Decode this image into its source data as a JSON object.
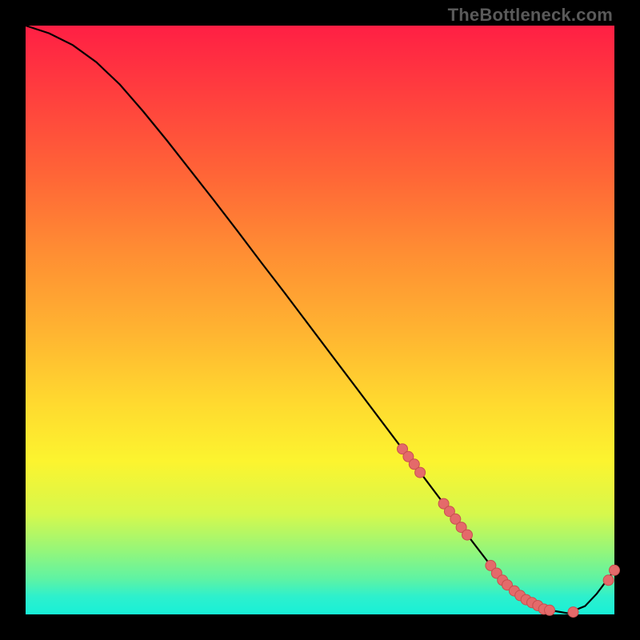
{
  "watermark": "TheBottleneck.com",
  "colors": {
    "curve": "#000000",
    "marker_fill": "#e46a6a",
    "marker_stroke": "#c84f4f"
  },
  "chart_data": {
    "type": "line",
    "title": "",
    "xlabel": "",
    "ylabel": "",
    "xlim": [
      0,
      100
    ],
    "ylim": [
      0,
      100
    ],
    "grid": false,
    "legend": false,
    "series": [
      {
        "name": "curve",
        "x": [
          0,
          4,
          8,
          12,
          16,
          20,
          24,
          28,
          32,
          36,
          40,
          44,
          48,
          52,
          56,
          60,
          64,
          68,
          72,
          76,
          80,
          84,
          88,
          92,
          95,
          97,
          100
        ],
        "y": [
          100.0,
          98.7,
          96.7,
          93.8,
          90.0,
          85.4,
          80.5,
          75.4,
          70.3,
          65.1,
          59.8,
          54.6,
          49.3,
          44.0,
          38.7,
          33.4,
          28.1,
          22.8,
          17.5,
          12.2,
          7.0,
          3.2,
          0.9,
          0.2,
          1.4,
          3.5,
          7.5
        ]
      }
    ],
    "markers": [
      {
        "x": 64.0,
        "y": 28.1
      },
      {
        "x": 65.0,
        "y": 26.8
      },
      {
        "x": 66.0,
        "y": 25.5
      },
      {
        "x": 67.0,
        "y": 24.1
      },
      {
        "x": 71.0,
        "y": 18.8
      },
      {
        "x": 72.0,
        "y": 17.5
      },
      {
        "x": 73.0,
        "y": 16.2
      },
      {
        "x": 74.0,
        "y": 14.8
      },
      {
        "x": 75.0,
        "y": 13.5
      },
      {
        "x": 79.0,
        "y": 8.3
      },
      {
        "x": 80.0,
        "y": 7.0
      },
      {
        "x": 81.0,
        "y": 5.8
      },
      {
        "x": 81.8,
        "y": 5.0
      },
      {
        "x": 83.0,
        "y": 4.0
      },
      {
        "x": 84.0,
        "y": 3.2
      },
      {
        "x": 85.0,
        "y": 2.5
      },
      {
        "x": 86.0,
        "y": 2.0
      },
      {
        "x": 87.0,
        "y": 1.5
      },
      {
        "x": 88.0,
        "y": 0.9
      },
      {
        "x": 89.0,
        "y": 0.7
      },
      {
        "x": 93.0,
        "y": 0.4
      },
      {
        "x": 99.0,
        "y": 5.8
      },
      {
        "x": 100.0,
        "y": 7.5
      }
    ]
  }
}
